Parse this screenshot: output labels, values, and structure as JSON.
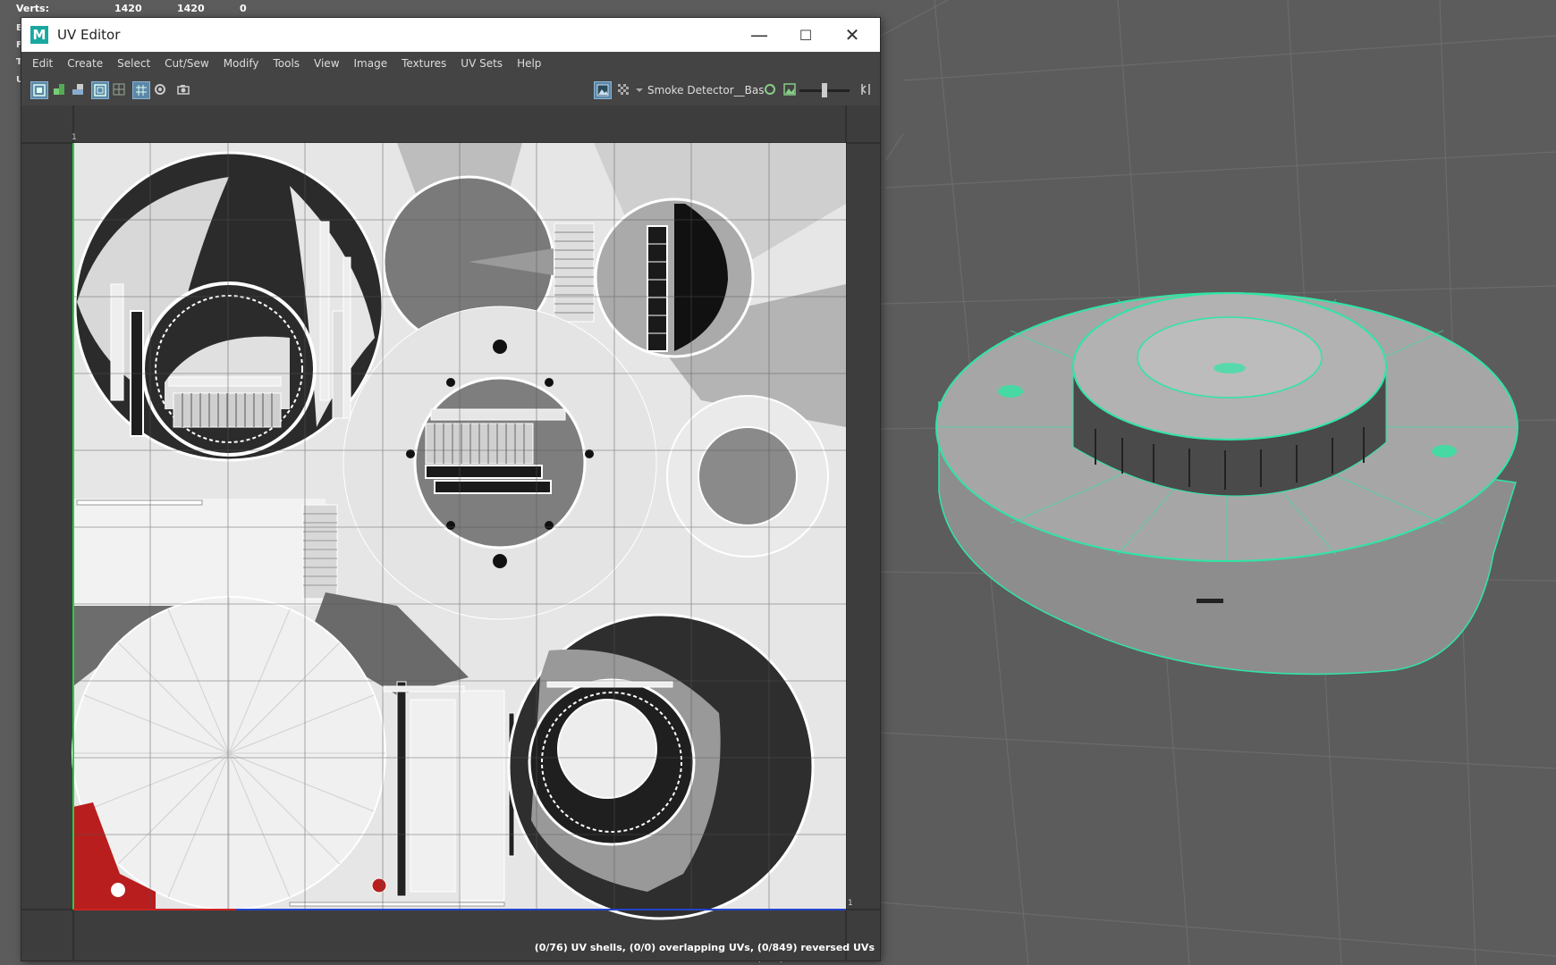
{
  "hud": {
    "verts_label": "Verts:",
    "verts_values": [
      "1420",
      "1420",
      "0"
    ],
    "cut_letters": [
      "E",
      "F",
      "T",
      "U"
    ]
  },
  "window": {
    "title": "UV Editor",
    "app_icon": "M",
    "minimize": "—",
    "maximize": "☐",
    "close": "✕"
  },
  "menu": [
    "Edit",
    "Create",
    "Select",
    "Cut/Sew",
    "Modify",
    "Tools",
    "View",
    "Image",
    "Textures",
    "UV Sets",
    "Help"
  ],
  "toolbar": {
    "texture_name": "Smoke Detector__Bas",
    "exposure_level": 0.5,
    "icons": [
      "uv-shell-icon",
      "uv-layout-icon",
      "uv-checker-icon",
      "grid-toggle-icon",
      "grid-icon",
      "snap-icon",
      "wire-icon",
      "shaded-icon",
      "camera-icon"
    ]
  },
  "uv": {
    "status": "(0/76) UV shells, (0/0) overlapping UVs, (0/849) reversed UVs",
    "corner_labels": [
      "1",
      "1"
    ]
  },
  "viewport": {
    "camera": "persp",
    "wire_color": "#2ee6a4"
  }
}
